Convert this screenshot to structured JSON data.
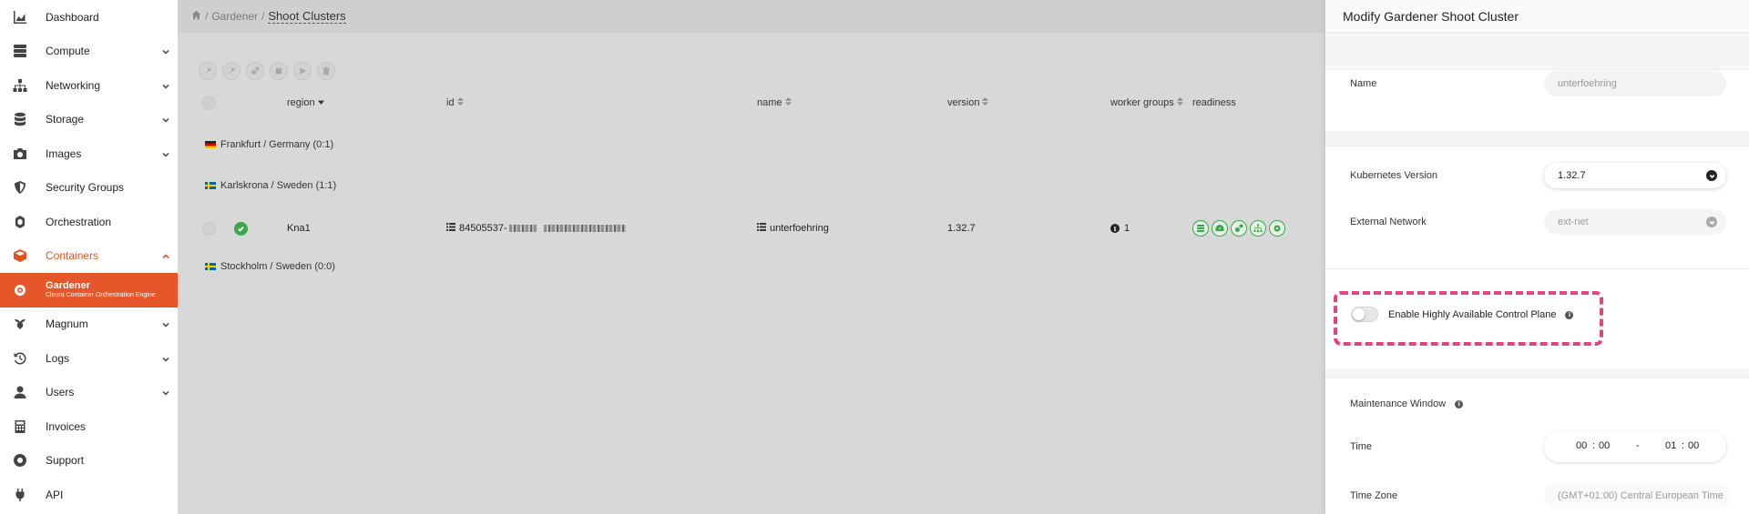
{
  "sidebar": {
    "items": [
      {
        "label": "Dashboard",
        "icon": "chart-area-icon",
        "expandable": false
      },
      {
        "label": "Compute",
        "icon": "server-icon",
        "expandable": true
      },
      {
        "label": "Networking",
        "icon": "sitemap-icon",
        "expandable": true
      },
      {
        "label": "Storage",
        "icon": "database-icon",
        "expandable": true
      },
      {
        "label": "Images",
        "icon": "camera-icon",
        "expandable": true
      },
      {
        "label": "Security Groups",
        "icon": "shield-icon",
        "expandable": false
      },
      {
        "label": "Orchestration",
        "icon": "orchestration-icon",
        "expandable": false
      },
      {
        "label": "Containers",
        "icon": "cube-icon",
        "expandable": true,
        "active": true
      }
    ],
    "sub_item": {
      "label": "Gardener",
      "sublabel": "Cleura Container Orchestration Engine",
      "icon": "gear-icon"
    },
    "items_after": [
      {
        "label": "Magnum",
        "icon": "magnum-icon",
        "expandable": true
      },
      {
        "label": "Logs",
        "icon": "history-icon",
        "expandable": true
      },
      {
        "label": "Users",
        "icon": "user-icon",
        "expandable": true
      },
      {
        "label": "Invoices",
        "icon": "calculator-icon",
        "expandable": false
      },
      {
        "label": "Support",
        "icon": "life-ring-icon",
        "expandable": false
      },
      {
        "label": "API",
        "icon": "plug-icon",
        "expandable": false
      }
    ]
  },
  "breadcrumb": {
    "sep": "/",
    "parent": "Gardener",
    "current": "Shoot Clusters"
  },
  "table": {
    "columns": {
      "region": "region",
      "id": "id",
      "name": "name",
      "version": "version",
      "worker_groups": "worker groups",
      "readiness": "readiness"
    },
    "groups": [
      {
        "label": "Frankfurt / Germany",
        "count": "(0:1)",
        "flag": "de"
      },
      {
        "label": "Karlskrona / Sweden",
        "count": "(1:1)",
        "flag": "se"
      },
      {
        "label": "Stockholm / Sweden",
        "count": "(0:0)",
        "flag": "se"
      }
    ],
    "row": {
      "region": "Kna1",
      "id": "84505537-",
      "name": "unterfoehring",
      "version": "1.32.7",
      "worker_groups": "1"
    }
  },
  "panel": {
    "title": "Modify Gardener Shoot Cluster",
    "name_label": "Name",
    "name_value": "unterfoehring",
    "k8s_label": "Kubernetes Version",
    "k8s_value": "1.32.7",
    "ext_label": "External Network",
    "ext_value": "ext-net",
    "ha_label": "Enable Highly Available Control Plane",
    "ha_enabled": false,
    "maint_label": "Maintenance Window",
    "time_label": "Time",
    "time_start_h": "00",
    "time_start_m": "00",
    "time_sep": ":",
    "time_dash": "-",
    "time_end_h": "01",
    "time_end_m": "00",
    "tz_label": "Time Zone",
    "tz_value": "(GMT+01:00) Central European Time"
  },
  "colors": {
    "accent": "#e5572a",
    "success": "#39a84a",
    "highlight": "#e2457a"
  }
}
